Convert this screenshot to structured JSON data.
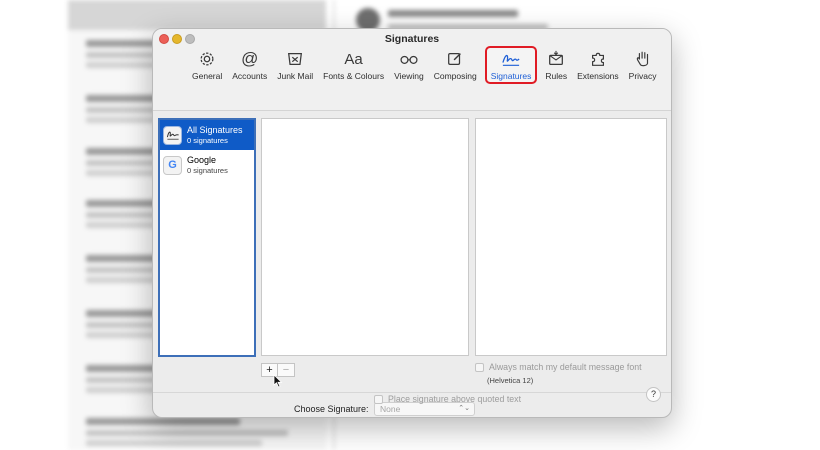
{
  "window": {
    "title": "Signatures"
  },
  "toolbar": {
    "items": [
      {
        "label": "General",
        "icon": "gear-icon"
      },
      {
        "label": "Accounts",
        "icon": "at-icon"
      },
      {
        "label": "Junk Mail",
        "icon": "junk-tray-icon"
      },
      {
        "label": "Fonts & Colours",
        "icon": "fonts-icon",
        "glyph": "Aa"
      },
      {
        "label": "Viewing",
        "icon": "glasses-icon"
      },
      {
        "label": "Composing",
        "icon": "pencil-square-icon"
      },
      {
        "label": "Signatures",
        "icon": "signature-icon",
        "active": true
      },
      {
        "label": "Rules",
        "icon": "envelope-rules-icon"
      },
      {
        "label": "Extensions",
        "icon": "puzzle-icon"
      },
      {
        "label": "Privacy",
        "icon": "hand-icon"
      }
    ]
  },
  "accounts": [
    {
      "name": "All Signatures",
      "count": "0 signatures",
      "icon": "signature-icon",
      "selected": true
    },
    {
      "name": "Google",
      "count": "0 signatures",
      "icon": "google-icon",
      "glyph": "G",
      "selected": false
    }
  ],
  "buttons": {
    "add": "+",
    "remove": "−"
  },
  "match_font": {
    "label": "Always match my default message font",
    "font": "(Helvetica 12)",
    "checked": false
  },
  "choose": {
    "label": "Choose Signature:",
    "value": "None"
  },
  "place_above": {
    "label": "Place signature above quoted text",
    "checked": false
  },
  "help": "?",
  "colors": {
    "accent": "#0f5bc7",
    "highlight_border": "#e01b24"
  }
}
